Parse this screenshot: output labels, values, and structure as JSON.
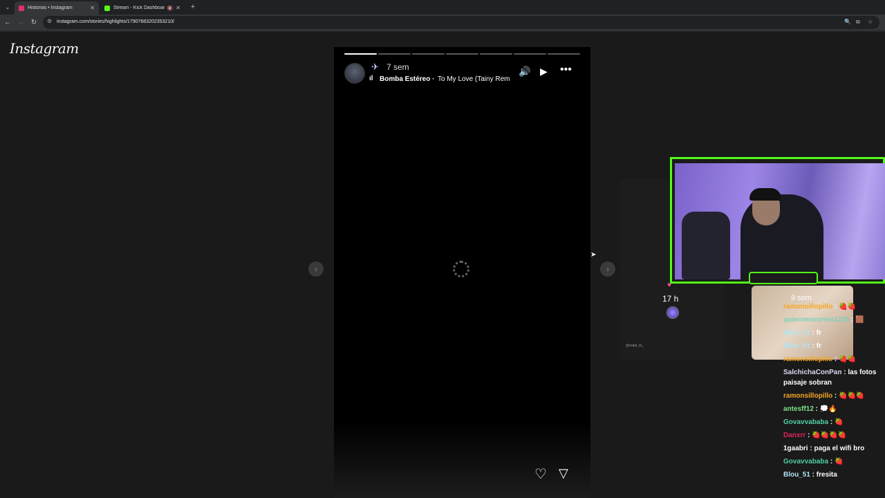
{
  "browser": {
    "tabs": [
      {
        "title": "Historias • Instagram",
        "favicon_color": "#e1306c"
      },
      {
        "title": "Stream - Kick Dashboard",
        "favicon_color": "#53fc18"
      }
    ],
    "url": "instagram.com/stories/highlights/17907683202353210/"
  },
  "page": {
    "logo": "Instagram"
  },
  "story": {
    "progress_segments": 7,
    "progress_current": 1,
    "time_ago": "7 sem",
    "music_artist": "Bomba Estéreo",
    "music_separator": "·",
    "music_song": "To My Love (Tainy Remix)"
  },
  "preview": {
    "time_ago": "17 h",
    "username": "@rodal_m_"
  },
  "overlay": {
    "thumb_time": "9 sem",
    "accent_color": "#53fc18"
  },
  "chat": {
    "messages": [
      {
        "user": "ramonsillopillo",
        "text": "🍓🍓",
        "color": "#f5a623"
      },
      {
        "user": "quieromisorteo1234",
        "text": "🟫",
        "color": "#7fd1b9"
      },
      {
        "user": "Blou_51",
        "text": "fr",
        "color": "#aee6f2"
      },
      {
        "user": "Blou_51",
        "text": "fr",
        "color": "#aee6f2"
      },
      {
        "user": "ramonsillopillo",
        "text": "🍓🍓",
        "color": "#f5a623"
      },
      {
        "user": "SalchichaConPan",
        "text": "las fotos paisaje sobran",
        "color": "#d9d9f5"
      },
      {
        "user": "ramonsillopillo",
        "text": "🍓🍓🍓",
        "color": "#f5a623"
      },
      {
        "user": "antesff12",
        "text": "💭🔥",
        "color": "#7fe08a"
      },
      {
        "user": "Govavvababa",
        "text": "🍓",
        "color": "#4fd1a0"
      },
      {
        "user": "Danxrr",
        "text": "🍓🍓🍓🍓",
        "color": "#e0245e"
      },
      {
        "user": "1gaabri",
        "text": "paga el wifi bro",
        "color": "#ffffff"
      },
      {
        "user": "Govavvababa",
        "text": "🍓",
        "color": "#4fd1a0"
      },
      {
        "user": "Blou_51",
        "text": "fresita",
        "color": "#aee6f2"
      }
    ]
  }
}
